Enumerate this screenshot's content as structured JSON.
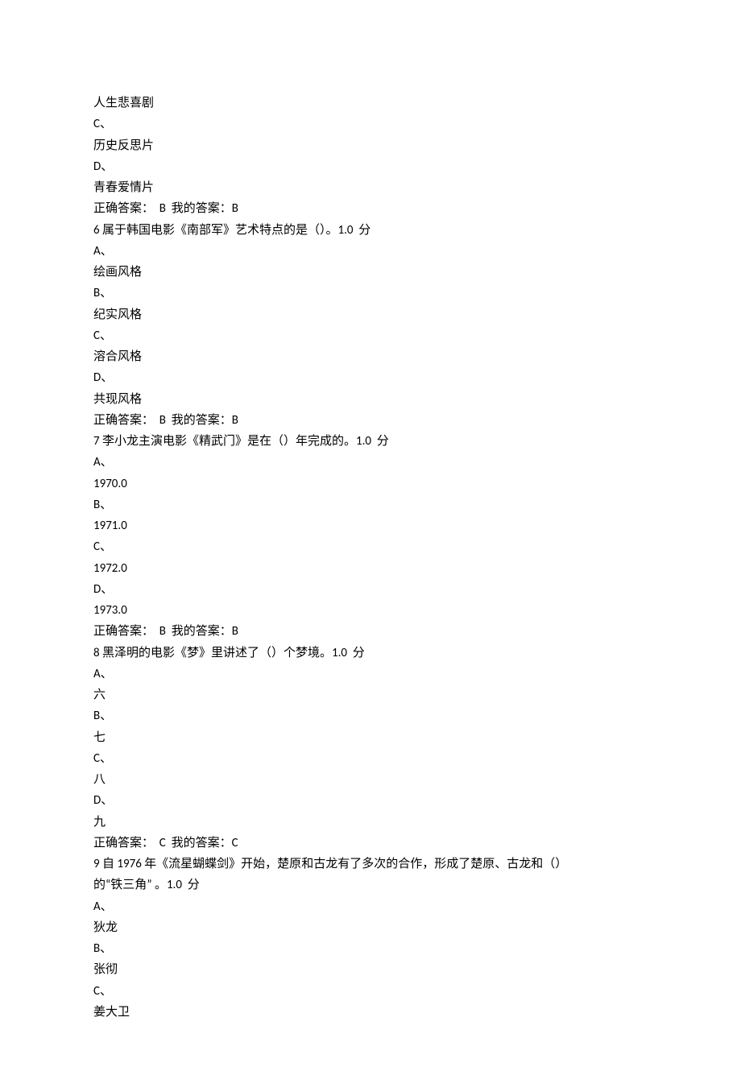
{
  "lines": [
    "人生悲喜剧",
    "C、",
    "历史反思片",
    "D、",
    "青春爱情片",
    "正确答案：  B  我的答案：B",
    "6 属于韩国电影《南部军》艺术特点的是（）。1.0  分",
    "A、",
    "绘画风格",
    "B、",
    "纪实风格",
    "C、",
    "溶合风格",
    "D、",
    "共现风格",
    "正确答案：  B  我的答案：B",
    "7 李小龙主演电影《精武门》是在（）年完成的。1.0  分",
    "A、",
    "1970.0",
    "B、",
    "1971.0",
    "C、",
    "1972.0",
    "D、",
    "1973.0",
    "正确答案：  B  我的答案：B",
    "8 黑泽明的电影《梦》里讲述了（）个梦境。1.0  分",
    "A、",
    "六",
    "B、",
    "七",
    "C、",
    "八",
    "D、",
    "九",
    "正确答案：  C  我的答案：C",
    "9 自 1976 年《流星蝴蝶剑》开始，楚原和古龙有了多次的合作，形成了楚原、古龙和（）",
    "的“铁三角” 。1.0  分",
    "A、",
    "狄龙",
    "B、",
    "张彻",
    "C、",
    "姜大卫"
  ]
}
